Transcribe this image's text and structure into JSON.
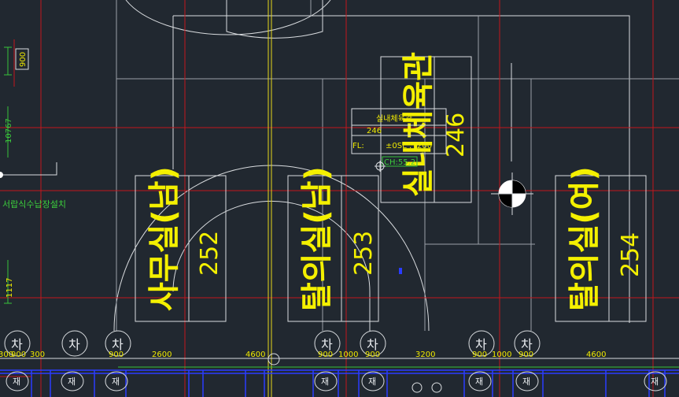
{
  "rooms": [
    {
      "name": "사무실(남)",
      "number": "252"
    },
    {
      "name": "탈의실(남)",
      "number": "253"
    },
    {
      "name": "탈의실(여)",
      "number": "254"
    },
    {
      "name": "실내체육관",
      "number": "246"
    }
  ],
  "room_tag": {
    "title": "실내체육관",
    "number": "246",
    "fl_label": "FL:",
    "fl_value": "±0SL : -200",
    "ch": "CH:55.2"
  },
  "left_note": "서랍식수납장설치",
  "vertical_dims": [
    "900",
    "10767",
    "1117"
  ],
  "bottom_dims": [
    "300",
    "900",
    "300",
    "900",
    "2600",
    "4600",
    "900",
    "1000",
    "900",
    "3200",
    "900",
    "1000",
    "900",
    "4600"
  ],
  "circle_mark": "차",
  "fixture_mark": "재",
  "colors": {
    "background": "#212830",
    "room_text": "#f4f000",
    "dim_text": "#f0ea00",
    "green_text": "#3ccf3c",
    "grid_red": "#c4161c",
    "grid_yellow": "#e6d81c",
    "lines_white": "#d9dcdf",
    "wall_blue": "#2a3cff"
  }
}
